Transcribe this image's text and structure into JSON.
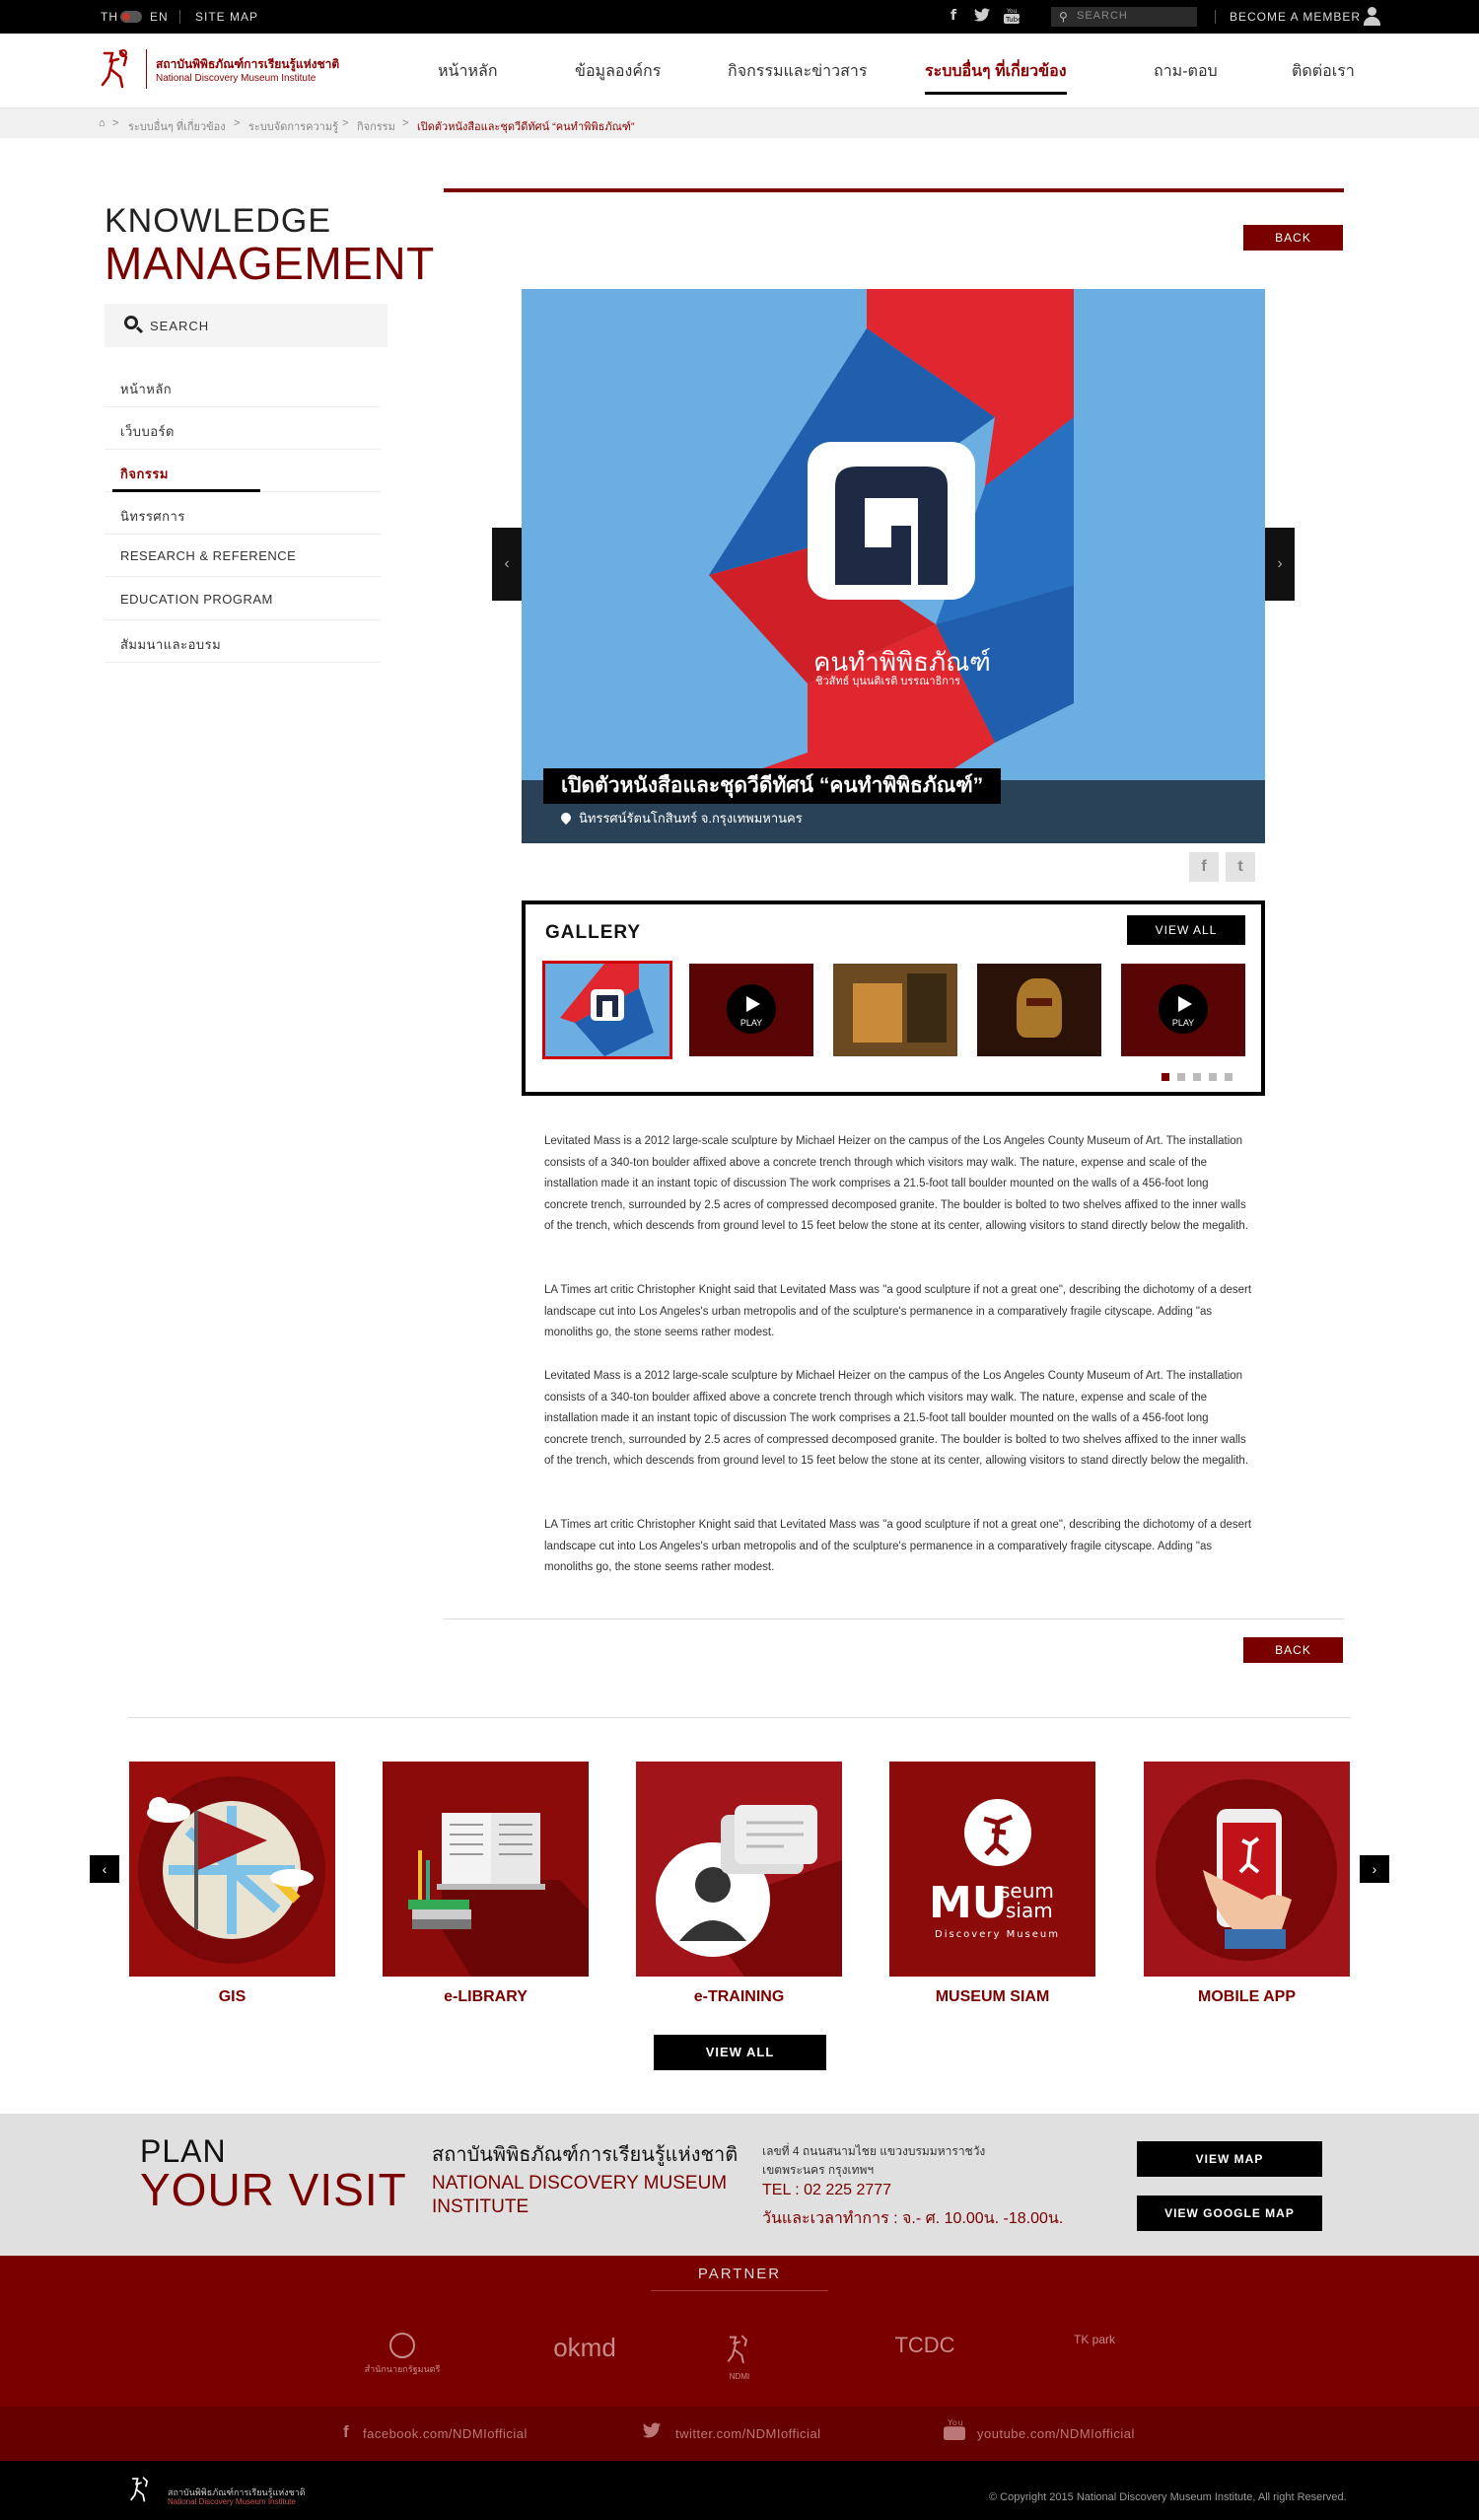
{
  "topbar": {
    "lang_th": "TH",
    "lang_en": "EN",
    "sitemap": "SITE MAP",
    "social_icons": [
      "facebook-icon",
      "twitter-icon",
      "youtube-icon"
    ],
    "search_placeholder": "SEARCH",
    "member": "BECOME A MEMBER"
  },
  "header": {
    "logo_th": "สถาบันพิพิธภัณฑ์การเรียนรู้แห่งชาติ",
    "logo_en": "National Discovery Museum Institute",
    "nav": [
      "หน้าหลัก",
      "ข้อมูลองค์กร",
      "กิจกรรมและข่าวสาร",
      "ระบบอื่นๆ ที่เกี่ยวข้อง",
      "ถาม-ตอบ",
      "ติดต่อเรา"
    ],
    "nav_active_index": 3
  },
  "breadcrumb": [
    "ระบบอื่นๆ ที่เกี่ยวข้อง",
    "ระบบจัดการความรู้",
    "กิจกรรม",
    "เปิดตัวหนังสือและชุดวีดีทัศน์ “คนทำพิพิธภัณฑ์”"
  ],
  "sidebar": {
    "title1": "KNOWLEDGE",
    "title2": "MANAGEMENT",
    "search_label": "SEARCH",
    "items": [
      "หน้าหลัก",
      "เว็บบอร์ด",
      "กิจกรรม",
      "นิทรรศการ",
      "RESEARCH & REFERENCE",
      "EDUCATION PROGRAM",
      "สัมมนาและอบรม"
    ],
    "active_index": 2
  },
  "article": {
    "back_label": "BACK",
    "hero_caption": "เปิดตัวหนังสือและชุดวีดีทัศน์ “คนทำพิพิธภัณฑ์”",
    "hero_location": "นิทรรศน์รัตนโกสินทร์ จ.กรุงเทพมหานคร",
    "hero_art_title": "คนทำพิพิธภัณฑ์",
    "hero_art_subtitle": "ชิวสัทธ์ บุนนติเรติ บรรณาธิการ",
    "share": [
      "f",
      "t"
    ],
    "gallery": {
      "title": "GALLERY",
      "view_all": "VIEW ALL",
      "play_label": "PLAY",
      "dots": 5
    },
    "paragraphs": [
      "Levitated Mass is a 2012 large-scale sculpture by Michael Heizer on the campus of the Los Angeles County Museum of Art. The installation consists of a 340-ton boulder affixed above a concrete trench through which visitors may walk. The nature, expense and scale of the installation made it an instant topic of discussion The work comprises a 21.5-foot tall boulder mounted on the walls of a 456-foot long concrete trench, surrounded by 2.5 acres of compressed decomposed granite. The boulder is bolted to two shelves affixed to the inner walls of the trench, which descends from ground level to 15 feet below the stone at its center, allowing visitors to stand directly below the megalith.",
      "LA Times art critic Christopher Knight said that Levitated Mass was \"a good sculpture if not a great one\", describing the dichotomy of a desert landscape cut into Los Angeles's urban metropolis and of the sculpture's permanence in a comparatively fragile cityscape. Adding \"as monoliths go, the stone seems rather modest.",
      "Levitated Mass is a 2012 large-scale sculpture by Michael Heizer on the campus of the Los Angeles County Museum of Art. The installation consists of a 340-ton boulder affixed above a concrete trench through which visitors may walk. The nature, expense and scale of the installation made it an instant topic of discussion The work comprises a 21.5-foot tall boulder mounted on the walls of a 456-foot long concrete trench, surrounded by 2.5 acres of compressed decomposed granite. The boulder is bolted to two shelves affixed to the inner walls of the trench, which descends from ground level to 15 feet below the stone at its center, allowing visitors to stand directly below the megalith.",
      "LA Times art critic Christopher Knight said that Levitated Mass was \"a good sculpture if not a great one\", describing the dichotomy of a desert landscape cut into Los Angeles's urban metropolis and of the sculpture's permanence in a comparatively fragile cityscape. Adding \"as monoliths go, the stone seems rather modest."
    ]
  },
  "services": {
    "items": [
      "GIS",
      "e-LIBRARY",
      "e-TRAINING",
      "MUSEUM SIAM",
      "MOBILE APP"
    ],
    "museum_logo": "MUseum siam",
    "museum_sub": "Discovery Museum",
    "view_all": "VIEW ALL"
  },
  "plan": {
    "line1": "PLAN",
    "line2": "YOUR VISIT",
    "org_th": "สถาบันพิพิธภัณฑ์การเรียนรู้แห่งชาติ",
    "org_en": "NATIONAL DISCOVERY MUSEUM INSTITUTE",
    "addr1": "เลขที่ 4 ถนนสนามไชย แขวงบรมมหาราชวัง",
    "addr2": "เขตพระนคร กรุงเทพฯ",
    "tel": "TEL : 02 225 2777",
    "hours": "วันและเวลาทำการ : จ.- ศ. 10.00น. -18.00น.",
    "view_map": "VIEW MAP",
    "view_google_map": "VIEW GOOGLE MAP"
  },
  "partner": {
    "title": "PARTNER",
    "logos": [
      "สำนักนายกรัฐมนตรี",
      "okmd",
      "NDMI",
      "TCDC",
      "TK park"
    ]
  },
  "social": {
    "facebook": "facebook.com/NDMIofficial",
    "twitter": "twitter.com/NDMIofficial",
    "youtube": "youtube.com/NDMIofficial"
  },
  "footer": {
    "org_th": "สถาบันพิพิธภัณฑ์การเรียนรู้แห่งชาติ",
    "org_en": "National Discovery Museum Institute",
    "copyright": "Copyright 2015 National Discovery Museum Institute, All right Reserved."
  },
  "colors": {
    "brand": "#7a0000",
    "hero_bg": "#6aaee2"
  }
}
